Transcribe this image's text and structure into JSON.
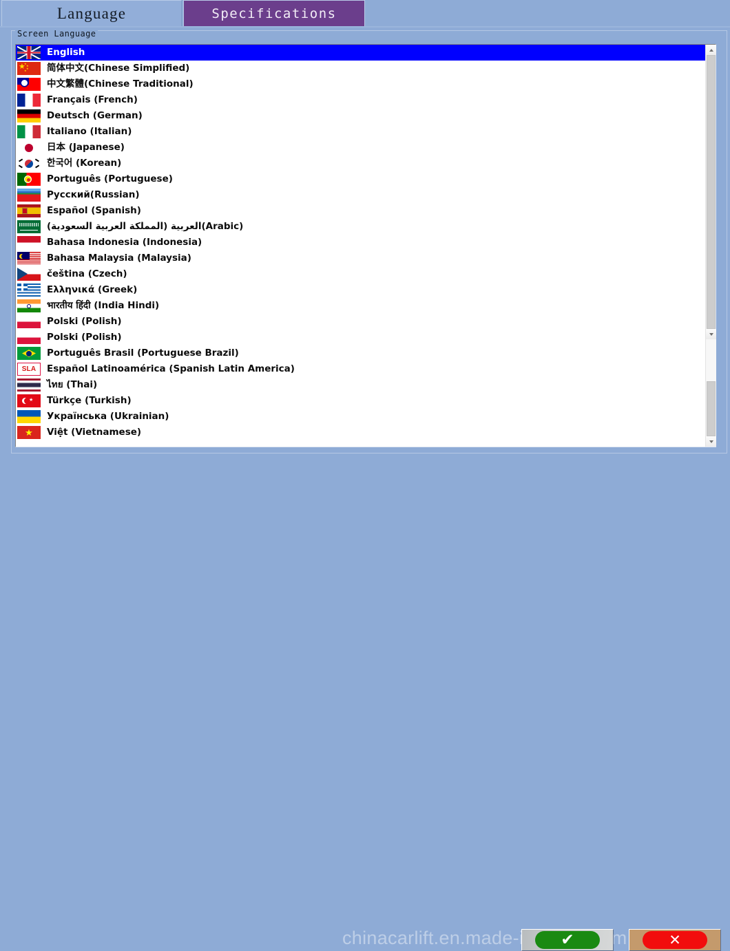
{
  "tabs": [
    {
      "id": "language",
      "label": "Language",
      "active": false
    },
    {
      "id": "specifications",
      "label": "Specifications",
      "active": true
    }
  ],
  "groupbox": {
    "legend": "Screen Language"
  },
  "colors": {
    "page_background": "#8eabd6",
    "tab_active": "#6b3e8c",
    "tab_inactive": "#92aed9",
    "selection": "#0000ff",
    "ok_button_pill": "#1a8a12",
    "cancel_button_pill": "#f20d0d",
    "ok_button_frame": "#c9cccd",
    "cancel_button_frame": "#c49a6c"
  },
  "language_list": {
    "selected_index": 0,
    "items": [
      {
        "label": "English",
        "flag": "uk-flag-icon",
        "flag_class": "f-uk"
      },
      {
        "label": "简体中文(Chinese Simplified)",
        "flag": "china-flag-icon",
        "flag_class": "f-cn"
      },
      {
        "label": "中文繁體(Chinese Traditional)",
        "flag": "taiwan-flag-icon",
        "flag_class": "f-tw"
      },
      {
        "label": "Français (French)",
        "flag": "france-flag-icon",
        "flag_class": "f-fr"
      },
      {
        "label": "Deutsch (German)",
        "flag": "germany-flag-icon",
        "flag_class": "f-de"
      },
      {
        "label": "Italiano (Italian)",
        "flag": "italy-flag-icon",
        "flag_class": "f-it"
      },
      {
        "label": "日本 (Japanese)",
        "flag": "japan-flag-icon",
        "flag_class": "f-jp"
      },
      {
        "label": "한국어 (Korean)",
        "flag": "korea-flag-icon",
        "flag_class": "f-kr"
      },
      {
        "label": "Português (Portuguese)",
        "flag": "portugal-flag-icon",
        "flag_class": "f-pt"
      },
      {
        "label": "Русский(Russian)",
        "flag": "russia-flag-icon",
        "flag_class": "f-ru"
      },
      {
        "label": "Español (Spanish)",
        "flag": "spain-flag-icon",
        "flag_class": "f-es"
      },
      {
        "label": "العربية (المملكة العربية السعودية)(Arabic)",
        "flag": "saudi-arabia-flag-icon",
        "flag_class": "f-sa"
      },
      {
        "label": "Bahasa Indonesia (Indonesia)",
        "flag": "indonesia-flag-icon",
        "flag_class": "f-id"
      },
      {
        "label": "Bahasa Malaysia (Malaysia)",
        "flag": "malaysia-flag-icon",
        "flag_class": "f-my"
      },
      {
        "label": "čeština (Czech)",
        "flag": "czech-flag-icon",
        "flag_class": "f-cz"
      },
      {
        "label": "Ελληνικά (Greek)",
        "flag": "greece-flag-icon",
        "flag_class": "f-gr"
      },
      {
        "label": "भारतीय हिंदी (India Hindi)",
        "flag": "india-flag-icon",
        "flag_class": "f-in"
      },
      {
        "label": "Polski (Polish)",
        "flag": "poland-flag-icon",
        "flag_class": "f-pl"
      },
      {
        "label": "Polski (Polish)",
        "flag": "poland-flag-icon",
        "flag_class": "f-pl"
      },
      {
        "label": "Português Brasil (Portuguese Brazil)",
        "flag": "brazil-flag-icon",
        "flag_class": "f-br"
      },
      {
        "label": "Español Latinoamérica (Spanish Latin America)",
        "flag": "sla-badge-icon",
        "flag_class": "f-sla",
        "badge_text": "SLA"
      },
      {
        "label": "ไทย (Thai)",
        "flag": "thailand-flag-icon",
        "flag_class": "f-th"
      },
      {
        "label": "Türkçe (Turkish)",
        "flag": "turkey-flag-icon",
        "flag_class": "f-tr"
      },
      {
        "label": "Українська (Ukrainian)",
        "flag": "ukraine-flag-icon",
        "flag_class": "f-ua"
      },
      {
        "label": "Việt (Vietnamese)",
        "flag": "vietnam-flag-icon",
        "flag_class": "f-vn"
      }
    ]
  },
  "footer": {
    "watermark": "chinacarlift.en.made-in-china.com",
    "ok_button": {
      "glyph": "✔",
      "icon": "check-icon"
    },
    "cancel_button": {
      "glyph": "✕",
      "icon": "close-icon"
    }
  },
  "scrollbar": {
    "up_arrow": "chevron-up-icon",
    "down_arrow": "chevron-down-icon",
    "mid_arrow": "chevron-down-icon"
  }
}
